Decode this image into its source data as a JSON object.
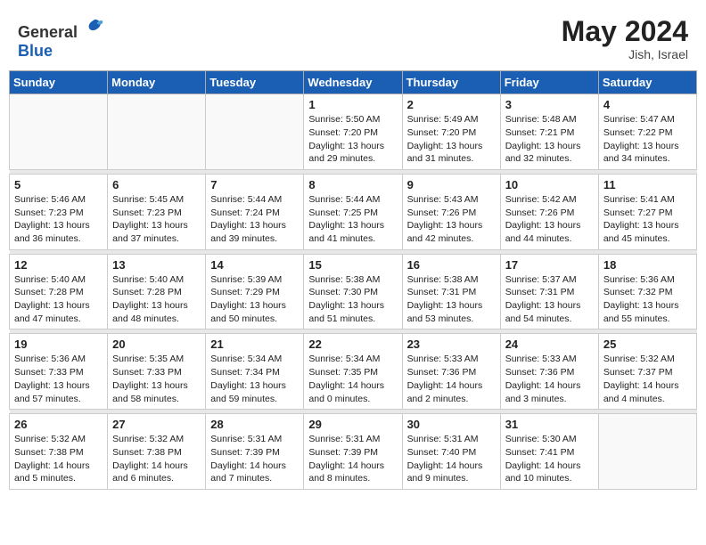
{
  "header": {
    "logo_general": "General",
    "logo_blue": "Blue",
    "month_year": "May 2024",
    "location": "Jish, Israel"
  },
  "days_of_week": [
    "Sunday",
    "Monday",
    "Tuesday",
    "Wednesday",
    "Thursday",
    "Friday",
    "Saturday"
  ],
  "weeks": [
    [
      {
        "day": "",
        "info": ""
      },
      {
        "day": "",
        "info": ""
      },
      {
        "day": "",
        "info": ""
      },
      {
        "day": "1",
        "info": "Sunrise: 5:50 AM\nSunset: 7:20 PM\nDaylight: 13 hours\nand 29 minutes."
      },
      {
        "day": "2",
        "info": "Sunrise: 5:49 AM\nSunset: 7:20 PM\nDaylight: 13 hours\nand 31 minutes."
      },
      {
        "day": "3",
        "info": "Sunrise: 5:48 AM\nSunset: 7:21 PM\nDaylight: 13 hours\nand 32 minutes."
      },
      {
        "day": "4",
        "info": "Sunrise: 5:47 AM\nSunset: 7:22 PM\nDaylight: 13 hours\nand 34 minutes."
      }
    ],
    [
      {
        "day": "5",
        "info": "Sunrise: 5:46 AM\nSunset: 7:23 PM\nDaylight: 13 hours\nand 36 minutes."
      },
      {
        "day": "6",
        "info": "Sunrise: 5:45 AM\nSunset: 7:23 PM\nDaylight: 13 hours\nand 37 minutes."
      },
      {
        "day": "7",
        "info": "Sunrise: 5:44 AM\nSunset: 7:24 PM\nDaylight: 13 hours\nand 39 minutes."
      },
      {
        "day": "8",
        "info": "Sunrise: 5:44 AM\nSunset: 7:25 PM\nDaylight: 13 hours\nand 41 minutes."
      },
      {
        "day": "9",
        "info": "Sunrise: 5:43 AM\nSunset: 7:26 PM\nDaylight: 13 hours\nand 42 minutes."
      },
      {
        "day": "10",
        "info": "Sunrise: 5:42 AM\nSunset: 7:26 PM\nDaylight: 13 hours\nand 44 minutes."
      },
      {
        "day": "11",
        "info": "Sunrise: 5:41 AM\nSunset: 7:27 PM\nDaylight: 13 hours\nand 45 minutes."
      }
    ],
    [
      {
        "day": "12",
        "info": "Sunrise: 5:40 AM\nSunset: 7:28 PM\nDaylight: 13 hours\nand 47 minutes."
      },
      {
        "day": "13",
        "info": "Sunrise: 5:40 AM\nSunset: 7:28 PM\nDaylight: 13 hours\nand 48 minutes."
      },
      {
        "day": "14",
        "info": "Sunrise: 5:39 AM\nSunset: 7:29 PM\nDaylight: 13 hours\nand 50 minutes."
      },
      {
        "day": "15",
        "info": "Sunrise: 5:38 AM\nSunset: 7:30 PM\nDaylight: 13 hours\nand 51 minutes."
      },
      {
        "day": "16",
        "info": "Sunrise: 5:38 AM\nSunset: 7:31 PM\nDaylight: 13 hours\nand 53 minutes."
      },
      {
        "day": "17",
        "info": "Sunrise: 5:37 AM\nSunset: 7:31 PM\nDaylight: 13 hours\nand 54 minutes."
      },
      {
        "day": "18",
        "info": "Sunrise: 5:36 AM\nSunset: 7:32 PM\nDaylight: 13 hours\nand 55 minutes."
      }
    ],
    [
      {
        "day": "19",
        "info": "Sunrise: 5:36 AM\nSunset: 7:33 PM\nDaylight: 13 hours\nand 57 minutes."
      },
      {
        "day": "20",
        "info": "Sunrise: 5:35 AM\nSunset: 7:33 PM\nDaylight: 13 hours\nand 58 minutes."
      },
      {
        "day": "21",
        "info": "Sunrise: 5:34 AM\nSunset: 7:34 PM\nDaylight: 13 hours\nand 59 minutes."
      },
      {
        "day": "22",
        "info": "Sunrise: 5:34 AM\nSunset: 7:35 PM\nDaylight: 14 hours\nand 0 minutes."
      },
      {
        "day": "23",
        "info": "Sunrise: 5:33 AM\nSunset: 7:36 PM\nDaylight: 14 hours\nand 2 minutes."
      },
      {
        "day": "24",
        "info": "Sunrise: 5:33 AM\nSunset: 7:36 PM\nDaylight: 14 hours\nand 3 minutes."
      },
      {
        "day": "25",
        "info": "Sunrise: 5:32 AM\nSunset: 7:37 PM\nDaylight: 14 hours\nand 4 minutes."
      }
    ],
    [
      {
        "day": "26",
        "info": "Sunrise: 5:32 AM\nSunset: 7:38 PM\nDaylight: 14 hours\nand 5 minutes."
      },
      {
        "day": "27",
        "info": "Sunrise: 5:32 AM\nSunset: 7:38 PM\nDaylight: 14 hours\nand 6 minutes."
      },
      {
        "day": "28",
        "info": "Sunrise: 5:31 AM\nSunset: 7:39 PM\nDaylight: 14 hours\nand 7 minutes."
      },
      {
        "day": "29",
        "info": "Sunrise: 5:31 AM\nSunset: 7:39 PM\nDaylight: 14 hours\nand 8 minutes."
      },
      {
        "day": "30",
        "info": "Sunrise: 5:31 AM\nSunset: 7:40 PM\nDaylight: 14 hours\nand 9 minutes."
      },
      {
        "day": "31",
        "info": "Sunrise: 5:30 AM\nSunset: 7:41 PM\nDaylight: 14 hours\nand 10 minutes."
      },
      {
        "day": "",
        "info": ""
      }
    ]
  ]
}
